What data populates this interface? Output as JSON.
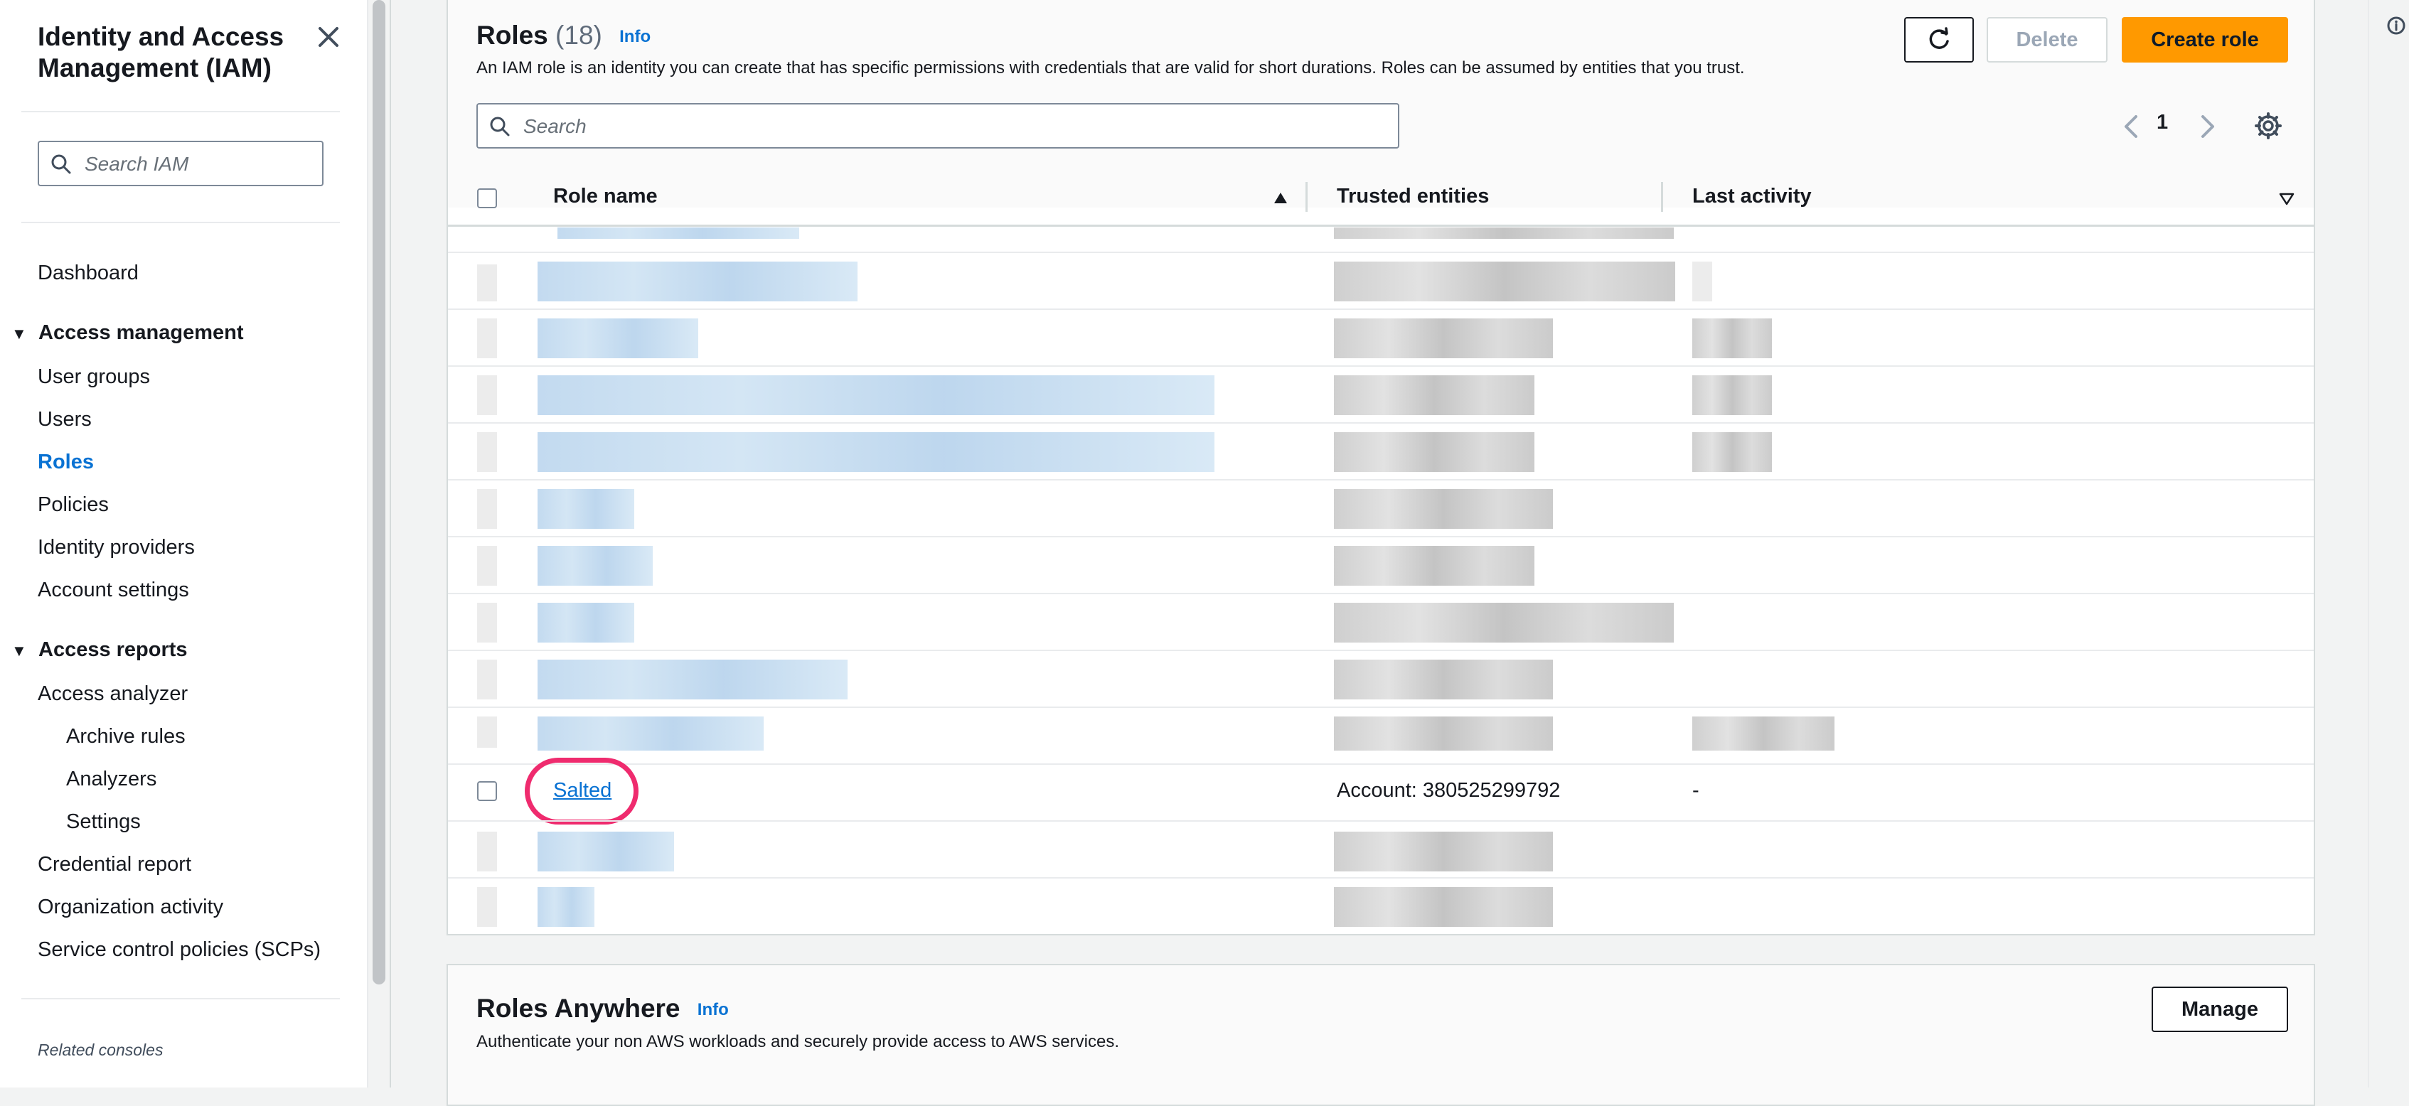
{
  "sidebar": {
    "title": "Identity and Access Management (IAM)",
    "search_placeholder": "Search IAM",
    "dashboard": "Dashboard",
    "access_management": "Access management",
    "user_groups": "User groups",
    "users": "Users",
    "roles": "Roles",
    "policies": "Policies",
    "identity_providers": "Identity providers",
    "account_settings": "Account settings",
    "access_reports": "Access reports",
    "access_analyzer": "Access analyzer",
    "archive_rules": "Archive rules",
    "analyzers": "Analyzers",
    "settings": "Settings",
    "credential_report": "Credential report",
    "organization_activity": "Organization activity",
    "scps": "Service control policies (SCPs)",
    "related_consoles": "Related consoles"
  },
  "roles_panel": {
    "title": "Roles",
    "count": "(18)",
    "info": "Info",
    "description": "An IAM role is an identity you can create that has specific permissions with credentials that are valid for short durations. Roles can be assumed by entities that you trust.",
    "delete_label": "Delete",
    "create_label": "Create role",
    "search_placeholder": "Search",
    "page_number": "1",
    "columns": {
      "role_name": "Role name",
      "trusted_entities": "Trusted entities",
      "last_activity": "Last activity"
    },
    "visible_row": {
      "role_name": "Salted",
      "trusted_entities": "Account: 380525299792",
      "last_activity": "-"
    }
  },
  "roles_anywhere": {
    "title": "Roles Anywhere",
    "info": "Info",
    "description": "Authenticate your non AWS workloads and securely provide access to AWS services.",
    "manage_label": "Manage"
  },
  "colors": {
    "accent_link": "#0972d3",
    "primary_button": "#ff9900",
    "highlight_ring": "#ef2b6e"
  }
}
